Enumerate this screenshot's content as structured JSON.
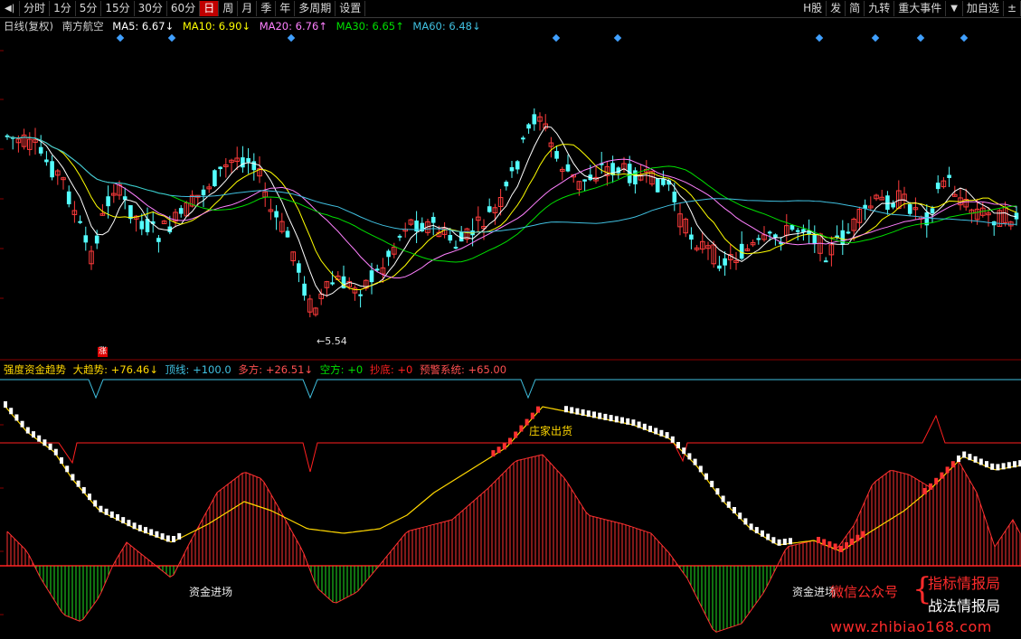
{
  "toolbar": {
    "back_icon": "back-arrow-icon",
    "left_items": [
      "分时",
      "1分",
      "5分",
      "15分",
      "30分",
      "60分",
      "日",
      "周",
      "月",
      "季",
      "年",
      "多周期",
      "设置"
    ],
    "active_index": 6,
    "right_items": [
      "H股",
      "发",
      "简",
      "九转",
      "重大事件"
    ],
    "dropdown_icon": "▼",
    "extra_items": [
      "加自选",
      "±"
    ]
  },
  "ma_header": {
    "period_label": "日线(复权)",
    "stock_name": "南方航空",
    "ma5": "MA5: 6.67↓",
    "ma10": "MA10: 6.90↓",
    "ma20": "MA20: 6.76↑",
    "ma30": "MA30: 6.65↑",
    "ma60": "MA60: 6.48↓"
  },
  "indicator_header": {
    "name": "强度资金趋势",
    "trend": "大趋势: +76.46↓",
    "top": "顶线: +100.0",
    "long": "多方: +26.51↓",
    "short": "空方: +0",
    "bottom": "抄底: +0",
    "warning": "预警系统: +65.00"
  },
  "labels": {
    "low_price": "←5.54",
    "zhang": "涨",
    "inflow_1": "资金进场",
    "inflow_2": "资金进场",
    "shipping": "庄家出货"
  },
  "watermark": {
    "wechat": "微信公众号",
    "brace": "{",
    "name1": "指标情报局",
    "name2": "战法情报局",
    "site": "www.zhibiao168.com"
  },
  "colors": {
    "up_candle": "#ff3b3b",
    "down_candle": "#54ffff",
    "ma5": "#ffffff",
    "ma10": "#ffff00",
    "ma20": "#ff80ff",
    "ma30": "#00e000",
    "ma60": "#40c0e0",
    "signal_diamond": "#40a0ff"
  }
}
